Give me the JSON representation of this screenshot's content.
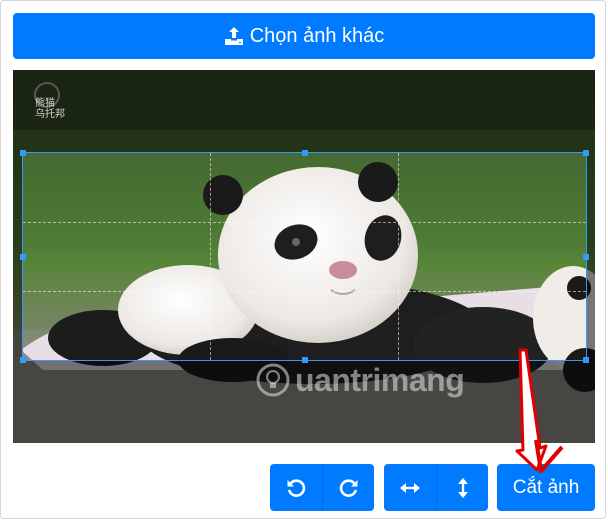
{
  "toolbar_top": {
    "choose_label": "Chọn ảnh khác"
  },
  "cropper": {
    "watermark_text": "uantrimang",
    "logo_line1": "熊猫",
    "logo_line2": "乌托邦"
  },
  "toolbar_bottom": {
    "crop_label": "Cắt ảnh",
    "rotate_left_icon": "rotate-left-icon",
    "rotate_right_icon": "rotate-right-icon",
    "flip_horizontal_icon": "flip-horizontal-icon",
    "flip_vertical_icon": "flip-vertical-icon"
  },
  "colors": {
    "primary": "#007bff",
    "crop_border": "#3399ff",
    "annotation": "#e00000"
  }
}
